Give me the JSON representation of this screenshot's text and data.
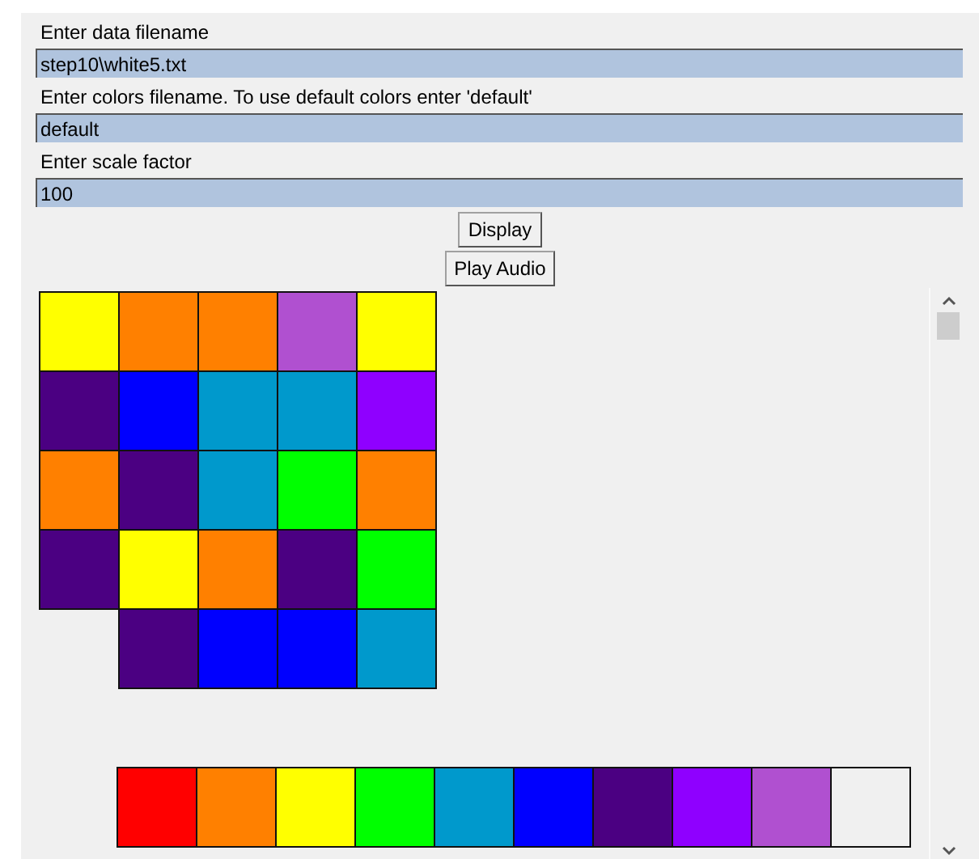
{
  "fields": [
    {
      "label": "Enter data filename",
      "value": "step10\\white5.txt"
    },
    {
      "label": "Enter colors filename. To use default colors enter 'default'",
      "value": "default"
    },
    {
      "label": "Enter scale factor",
      "value": "100"
    }
  ],
  "buttons": [
    "Display",
    "Play Audio"
  ],
  "grid": [
    [
      {
        "kind": "tile",
        "color": "#ffff00"
      },
      {
        "kind": "tile",
        "color": "#ff8000"
      },
      {
        "kind": "tile",
        "color": "#ff8000"
      },
      {
        "kind": "tile",
        "color": "#b050d0"
      },
      {
        "kind": "tile",
        "color": "#ffff00"
      }
    ],
    [
      {
        "kind": "tile",
        "color": "#4b0082"
      },
      {
        "kind": "tile",
        "color": "#0000ff"
      },
      {
        "kind": "tile",
        "color": "#0099cc"
      },
      {
        "kind": "tile",
        "color": "#0099cc"
      },
      {
        "kind": "tile",
        "color": "#8f00ff"
      }
    ],
    [
      {
        "kind": "tile",
        "color": "#ff8000"
      },
      {
        "kind": "tile",
        "color": "#4b0082"
      },
      {
        "kind": "tile",
        "color": "#0099cc"
      },
      {
        "kind": "tile",
        "color": "#00ff00"
      },
      {
        "kind": "tile",
        "color": "#ff8000"
      }
    ],
    [
      {
        "kind": "tile",
        "color": "#4b0082"
      },
      {
        "kind": "tile",
        "color": "#ffff00"
      },
      {
        "kind": "tile",
        "color": "#ff8000"
      },
      {
        "kind": "tile",
        "color": "#4b0082"
      },
      {
        "kind": "tile",
        "color": "#00ff00"
      }
    ],
    [
      {
        "kind": "blank"
      },
      {
        "kind": "tile",
        "color": "#4b0082"
      },
      {
        "kind": "tile",
        "color": "#0000ff"
      },
      {
        "kind": "tile",
        "color": "#0000ff"
      },
      {
        "kind": "tile",
        "color": "#0099cc"
      }
    ]
  ],
  "palette": [
    {
      "color": "#ff0000"
    },
    {
      "color": "#ff8000"
    },
    {
      "color": "#ffff00"
    },
    {
      "color": "#00ff00"
    },
    {
      "color": "#0099cc"
    },
    {
      "color": "#0000ff"
    },
    {
      "color": "#4b0082"
    },
    {
      "color": "#8f00ff"
    },
    {
      "color": "#b050d0"
    },
    {
      "color": "#f0f0f0"
    }
  ]
}
